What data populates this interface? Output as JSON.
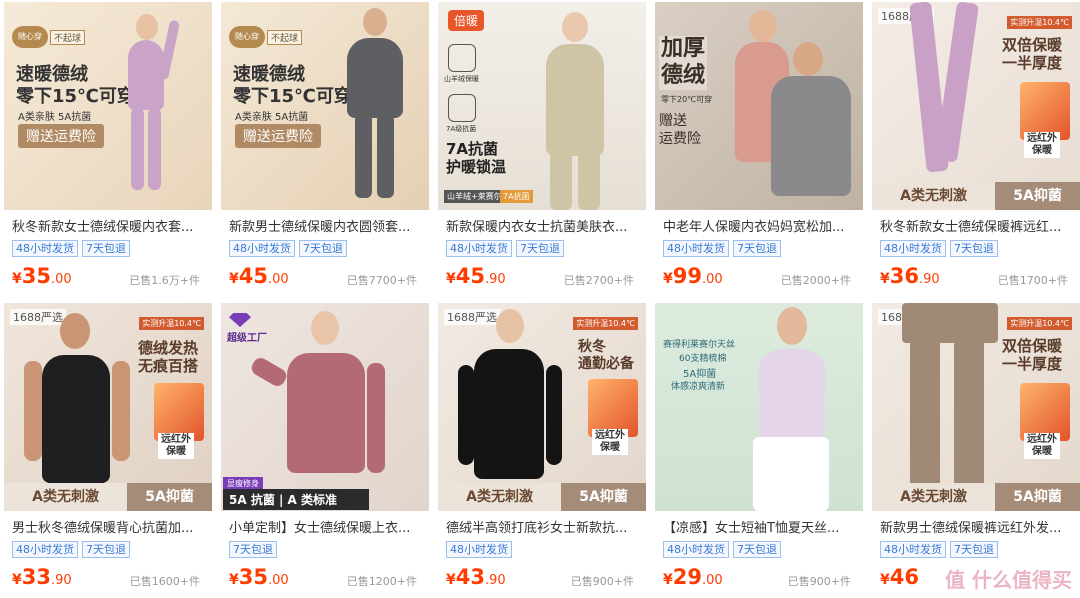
{
  "products": [
    {
      "title": "秋冬新款女士德绒保暖内衣套...",
      "tags": [
        "48小时发货",
        "7天包退"
      ],
      "currency": "¥",
      "price_int": "35",
      "price_dec": ".00",
      "sold": "已售1.6万+件",
      "image": {
        "logo1": "随心穿",
        "logo2": "不起球",
        "headline": "速暖德绒\n零下15℃可穿",
        "sub": "A类亲肤  5A抗菌",
        "gift": "赠送运费险"
      }
    },
    {
      "title": "新款男士德绒保暖内衣圆领套...",
      "tags": [
        "48小时发货",
        "7天包退"
      ],
      "currency": "¥",
      "price_int": "45",
      "price_dec": ".00",
      "sold": "已售7700+件",
      "image": {
        "logo1": "随心穿",
        "logo2": "不起球",
        "headline": "速暖德绒\n零下15℃可穿",
        "sub": "A类亲肤  5A抗菌",
        "gift": "赠送运费险"
      }
    },
    {
      "title": "新款保暖内衣女士抗菌美肤衣...",
      "tags": [
        "48小时发货",
        "7天包退"
      ],
      "currency": "¥",
      "price_int": "45",
      "price_dec": ".90",
      "sold": "已售2700+件",
      "image": {
        "brand": "倍暖",
        "headline": "7A抗菌\n护暖锁温",
        "feat1": "山羊绒保暖",
        "feat2": "7A级抗菌",
        "foot1": "山羊绒+莱赛尔",
        "foot2": "7A抗菌"
      }
    },
    {
      "title": "中老年人保暖内衣妈妈宽松加...",
      "tags": [
        "48小时发货",
        "7天包退"
      ],
      "currency": "¥",
      "price_int": "99",
      "price_dec": ".00",
      "sold": "已售2000+件",
      "image": {
        "headline": "加厚\n德绒",
        "sub": "零下20℃可穿",
        "gift": "赠送\n运费险"
      }
    },
    {
      "title": "秋冬新款女士德绒保暖裤远红...",
      "tags": [
        "48小时发货",
        "7天包退"
      ],
      "currency": "¥",
      "price_int": "36",
      "price_dec": ".90",
      "sold": "已售1700+件",
      "image": {
        "badge": "1688严选",
        "temp": "实测升温10.4℃",
        "headline": "双倍保暖\n一半厚度",
        "warm": "远红外\n保暖",
        "bar_left": "A类无刺激",
        "bar_right": "5A抑菌"
      }
    },
    {
      "title": "男士秋冬德绒保暖背心抗菌加...",
      "tags": [
        "48小时发货",
        "7天包退"
      ],
      "currency": "¥",
      "price_int": "33",
      "price_dec": ".90",
      "sold": "已售1600+件",
      "image": {
        "badge": "1688严选",
        "temp": "实测升温10.4℃",
        "headline": "德绒发热\n无痕百搭",
        "warm": "远红外\n保暖",
        "bar_left": "A类无刺激",
        "bar_right": "5A抑菌"
      }
    },
    {
      "title": "小单定制】女士德绒保暖上衣...",
      "tags": [
        "7天包退"
      ],
      "currency": "¥",
      "price_int": "35",
      "price_dec": ".00",
      "sold": "已售1200+件",
      "image": {
        "brand": "超级工厂",
        "chip": "显瘦修身",
        "bar": "5A 抗菌 | A 类标准"
      }
    },
    {
      "title": "德绒半高领打底衫女士新款抗...",
      "tags": [
        "48小时发货"
      ],
      "currency": "¥",
      "price_int": "43",
      "price_dec": ".90",
      "sold": "已售900+件",
      "image": {
        "badge": "1688严选",
        "temp": "实测升温10.4℃",
        "headline": "秋冬\n通勤必备",
        "warm": "远红外\n保暖",
        "bar_left": "A类无刺激",
        "bar_right": "5A抑菌"
      }
    },
    {
      "title": "【凉感】女士短袖T恤夏天丝...",
      "tags": [
        "48小时发货",
        "7天包退"
      ],
      "currency": "¥",
      "price_int": "29",
      "price_dec": ".00",
      "sold": "已售900+件",
      "image": {
        "line1": "赛得利莱赛尔天丝",
        "line2": "60支精梳棉",
        "line3": "5A抑菌",
        "line4": "体感凉爽清新"
      }
    },
    {
      "title": "新款男士德绒保暖裤远红外发...",
      "tags": [
        "48小时发货",
        "7天包退"
      ],
      "currency": "¥",
      "price_int": "46",
      "price_dec": "",
      "sold": "",
      "image": {
        "badge": "1688严选",
        "temp": "实测升温10.4℃",
        "headline": "双倍保暖\n一半厚度",
        "warm": "远红外\n保暖",
        "bar_left": "A类无刺激",
        "bar_right": "5A抑菌"
      }
    }
  ],
  "watermark": "值 什么值得买"
}
